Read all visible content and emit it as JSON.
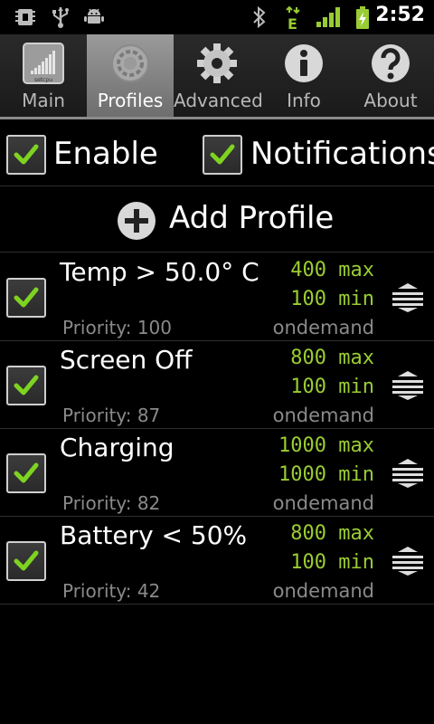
{
  "status_bar": {
    "time": "2:52",
    "icons": [
      "setcpu-chip-icon",
      "usb-icon",
      "android-debug-icon",
      "bluetooth-icon",
      "edge-data-icon",
      "signal-icon",
      "battery-charging-icon"
    ],
    "accent": "#99cc33"
  },
  "tabs": [
    {
      "label": "Main",
      "icon": "setcpu-app-icon",
      "selected": false
    },
    {
      "label": "Profiles",
      "icon": "gear-disc-icon",
      "selected": true
    },
    {
      "label": "Advanced",
      "icon": "gear-icon",
      "selected": false
    },
    {
      "label": "Info",
      "icon": "info-icon",
      "selected": false
    },
    {
      "label": "About",
      "icon": "question-icon",
      "selected": false
    }
  ],
  "toggles": {
    "enable": {
      "label": "Enable",
      "checked": true
    },
    "notifications": {
      "label": "Notifications",
      "checked": true
    }
  },
  "add_profile": {
    "label": "Add Profile",
    "icon": "plus-circle-icon"
  },
  "profiles": [
    {
      "name": "Temp > 50.0° C",
      "max": "400 max",
      "min": "100 min",
      "priority": "Priority: 100",
      "governor": "ondemand",
      "checked": true
    },
    {
      "name": "Screen Off",
      "max": "800 max",
      "min": "100 min",
      "priority": "Priority: 87",
      "governor": "ondemand",
      "checked": true
    },
    {
      "name": "Charging",
      "max": "1000 max",
      "min": "1000 min",
      "priority": "Priority: 82",
      "governor": "ondemand",
      "checked": true
    },
    {
      "name": "Battery < 50%",
      "max": "800 max",
      "min": "100 min",
      "priority": "Priority: 42",
      "governor": "ondemand",
      "checked": true
    }
  ],
  "colors": {
    "freq_green": "#9acd32",
    "check_green": "#7ed321",
    "muted_text": "#8a8a8a"
  }
}
